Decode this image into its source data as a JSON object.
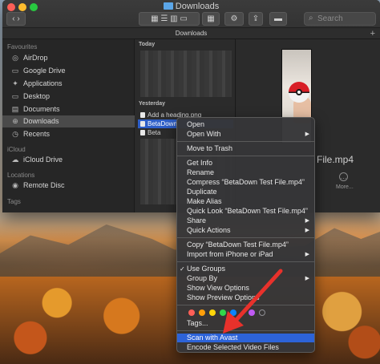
{
  "window": {
    "title": "Downloads",
    "path_title": "Downloads",
    "search_placeholder": "Search"
  },
  "sidebar": {
    "favourites_heading": "Favourites",
    "icloud_heading": "iCloud",
    "locations_heading": "Locations",
    "tags_heading": "Tags",
    "favourites": [
      {
        "label": "AirDrop",
        "icon": "airdrop-icon"
      },
      {
        "label": "Google Drive",
        "icon": "drive-icon"
      },
      {
        "label": "Applications",
        "icon": "applications-icon"
      },
      {
        "label": "Desktop",
        "icon": "desktop-icon"
      },
      {
        "label": "Documents",
        "icon": "documents-icon"
      },
      {
        "label": "Downloads",
        "icon": "downloads-icon",
        "selected": true
      },
      {
        "label": "Recents",
        "icon": "recents-icon"
      }
    ],
    "icloud": [
      {
        "label": "iCloud Drive",
        "icon": "cloud-icon"
      }
    ],
    "locations": [
      {
        "label": "Remote Disc",
        "icon": "disc-icon"
      }
    ]
  },
  "column": {
    "today_heading": "Today",
    "yesterday_heading": "Yesterday",
    "files": [
      {
        "name": "Add a heading.png"
      },
      {
        "name": "BetaDown",
        "selected": true
      },
      {
        "name": "Beta"
      }
    ]
  },
  "preview": {
    "file_name": "File.mp4",
    "more_label": "More..."
  },
  "context_menu": {
    "items_group1": [
      "Open",
      "Open With"
    ],
    "items_group2": [
      "Move to Trash"
    ],
    "items_group3": [
      "Get Info",
      "Rename",
      "Compress “BetaDown Test File.mp4”",
      "Duplicate",
      "Make Alias",
      "Quick Look “BetaDown Test File.mp4”",
      "Share",
      "Quick Actions"
    ],
    "items_group4": [
      "Copy “BetaDown Test File.mp4”",
      "Import from iPhone or iPad"
    ],
    "items_group5": [
      "Use Groups",
      "Group By",
      "Show View Options",
      "Show Preview Options"
    ],
    "tags_label": "Tags...",
    "scan_label": "Scan with Avast",
    "encode_label": "Encode Selected Video Files",
    "tag_colors": [
      "#ff5f57",
      "#ff9f0a",
      "#ffd60a",
      "#32d74b",
      "#0a84ff",
      "#bf5af2",
      "#8e8e93"
    ]
  },
  "colors": {
    "accent": "#2d63d8",
    "arrow": "#e8312b"
  }
}
